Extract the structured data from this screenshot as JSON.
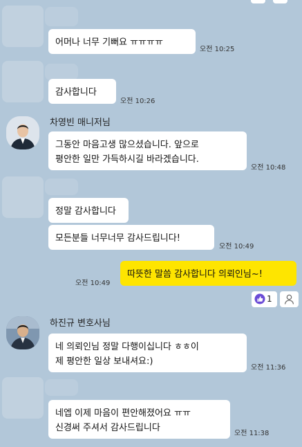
{
  "colors": {
    "background": "#b2c7d9",
    "bubble_other": "#ffffff",
    "bubble_mine": "#fee500",
    "reaction_icon": "#6b4cd6"
  },
  "messages": [
    {
      "id": "m1",
      "sender": "",
      "lines": [
        "어머나 너무 기뻐요 ㅠㅠㅠㅠ"
      ],
      "time": "오전 10:25"
    },
    {
      "id": "m2",
      "sender": "",
      "lines": [
        "감사합니다"
      ],
      "time": "오전 10:26"
    },
    {
      "id": "m3",
      "sender": "차영빈 매니저님",
      "lines": [
        "그동안 마음고생 많으셨습니다. 앞으로",
        "평안한 일만 가득하시길 바라겠습니다."
      ],
      "time": "오전 10:48"
    },
    {
      "id": "m4",
      "sender": "",
      "lines": [
        "정말 감사합니다"
      ],
      "time": ""
    },
    {
      "id": "m5",
      "sender": "",
      "lines": [
        "모든분들 너무너무 감사드립니다!"
      ],
      "time": "오전 10:49"
    },
    {
      "id": "m6",
      "sender": "me",
      "lines": [
        "따뜻한 말씀 감사합니다 의뢰인님~!"
      ],
      "time": "오전 10:49"
    },
    {
      "id": "m7",
      "sender": "하진규 변호사님",
      "lines": [
        "네 의뢰인님 정말 다행이십니다 ㅎㅎ이",
        "제 평안한 일상 보내셔요:)"
      ],
      "time": "오전 11:36"
    },
    {
      "id": "m8",
      "sender": "",
      "lines": [
        "네엡 이제 마음이 편안해졌어요 ㅠㅠ",
        "신경써 주셔서 감사드립니다"
      ],
      "time": "오전 11:38"
    }
  ],
  "reaction": {
    "count": "1",
    "icon": "like-reaction-icon"
  }
}
